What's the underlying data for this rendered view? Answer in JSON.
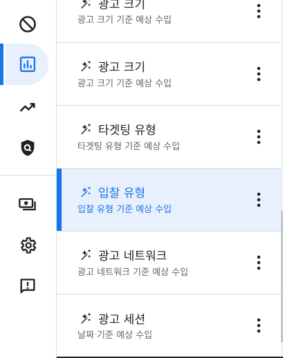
{
  "colors": {
    "accent": "#1a73e8",
    "selected_bg": "#e8f0fe",
    "text_primary": "#202124",
    "text_secondary": "#5f6368",
    "divider": "#dadce0"
  },
  "sidebar": {
    "items": [
      {
        "icon": "block-icon",
        "selected": false
      },
      {
        "icon": "bar-chart-icon",
        "selected": true
      },
      {
        "icon": "trending-up-icon",
        "selected": false
      },
      {
        "icon": "shield-search-icon",
        "selected": false
      },
      {
        "icon": "payments-icon",
        "selected": false
      },
      {
        "icon": "gear-icon",
        "selected": false
      },
      {
        "icon": "feedback-icon",
        "selected": false
      }
    ]
  },
  "reports": {
    "items": [
      {
        "title": "광고 크기",
        "subtitle": "광고 크기 기준 예상 수입",
        "selected": false
      },
      {
        "title": "광고 크기",
        "subtitle": "광고 크기 기준 예상 수입",
        "selected": false
      },
      {
        "title": "타겟팅 유형",
        "subtitle": "타겟팅 유형 기준 예상 수입",
        "selected": false
      },
      {
        "title": "입찰 유형",
        "subtitle": "입찰 유형 기준 예상 수입",
        "selected": true
      },
      {
        "title": "광고 네트워크",
        "subtitle": "광고 네트워크 기준 예상 수입",
        "selected": false
      },
      {
        "title": "광고 세션",
        "subtitle": "날짜 기준 예상 수입",
        "selected": false
      }
    ],
    "item_icon": "auto-awesome-sparkle-icon",
    "menu_icon": "more-vert-icon"
  }
}
